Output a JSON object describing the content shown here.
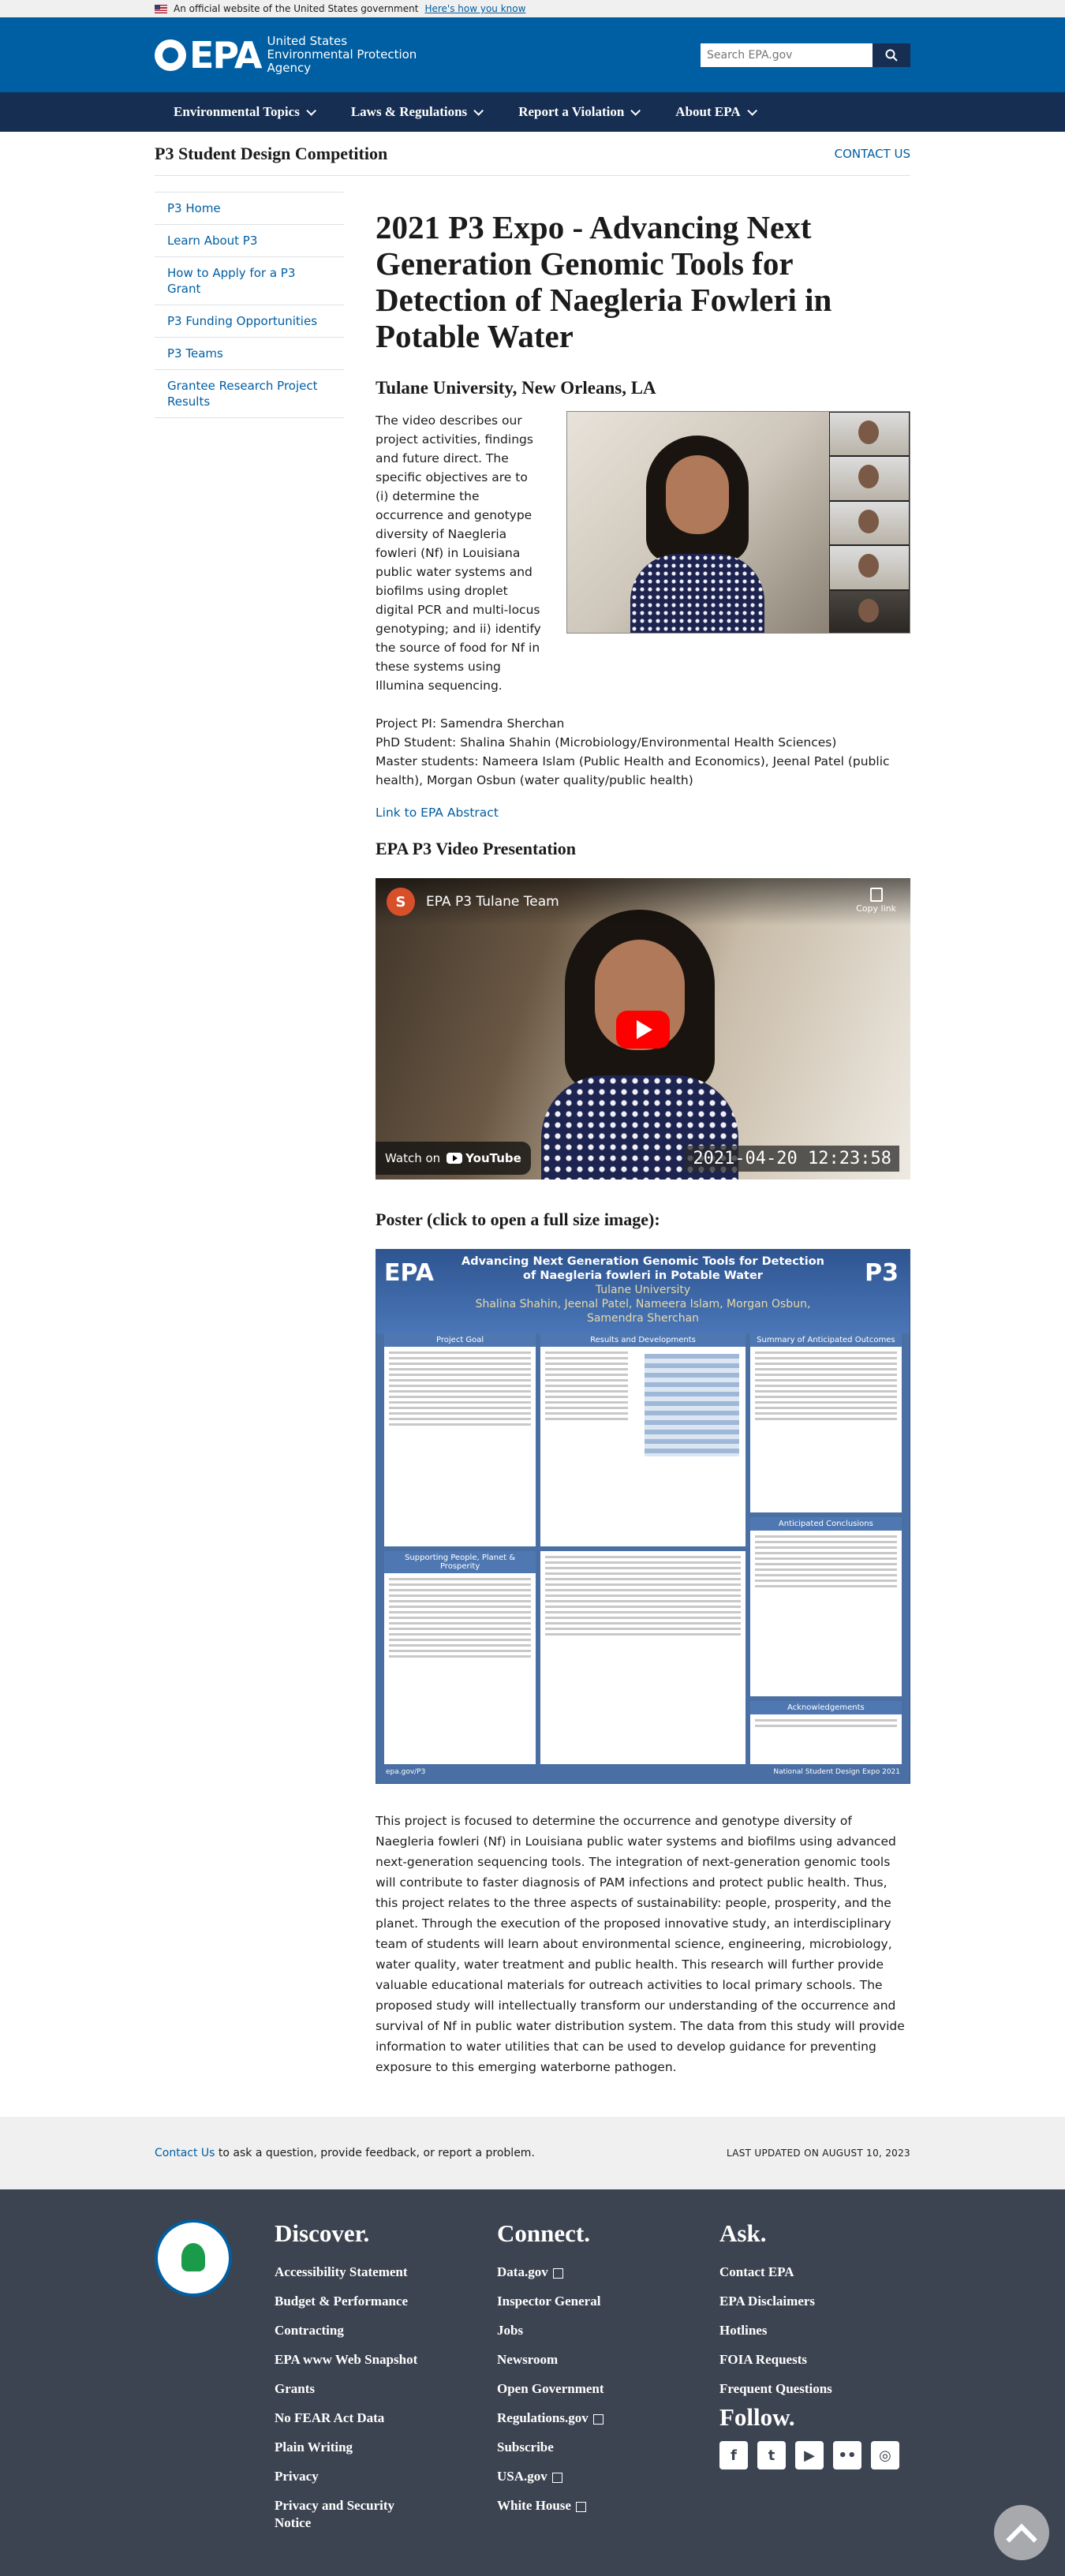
{
  "gov_banner": {
    "text": "An official website of the United States government",
    "link": "Here's how you know"
  },
  "header": {
    "logo": "EPA",
    "agency": [
      "United States",
      "Environmental Protection",
      "Agency"
    ],
    "search_placeholder": "Search EPA.gov"
  },
  "nav": [
    "Environmental Topics",
    "Laws & Regulations",
    "Report a Violation",
    "About EPA"
  ],
  "page": {
    "section_title": "P3 Student Design Competition",
    "contact": "CONTACT US"
  },
  "sidenav": [
    "P3 Home",
    "Learn About P3",
    "How to Apply for a P3 Grant",
    "P3 Funding Opportunities",
    "P3 Teams",
    "Grantee Research Project Results"
  ],
  "content": {
    "title": "2021 P3 Expo - Advancing Next Generation Genomic Tools for Detection of Naegleria Fowleri in Potable Water",
    "subtitle": "Tulane University, New Orleans, LA",
    "intro": "The video describes our project activities, findings and future direct. The specific objectives are to (i) determine the occurrence and genotype diversity of Naegleria fowleri (Nf) in Louisiana public water systems and biofilms using droplet digital PCR and multi-locus genotyping; and ii) identify the source of food for Nf in these systems using Illumina sequencing.",
    "credits": [
      "Project PI: Samendra Sherchan",
      "PhD Student: Shalina Shahin (Microbiology/Environmental Health Sciences)",
      "Master students: Nameera Islam (Public Health and Economics), Jeenal Patel (public health), Morgan Osbun (water quality/public health)"
    ],
    "abstract_link": "Link to EPA Abstract",
    "video_heading": "EPA P3 Video Presentation",
    "video": {
      "channel_initial": "S",
      "channel": "EPA P3 Tulane Team",
      "copy": "Copy link",
      "watch_on": "Watch on",
      "youtube": "YouTube",
      "timestamp": "2021-04-20  12:23:58"
    },
    "poster_heading": "Poster (click to open a full size image):",
    "poster": {
      "logo": "EPA",
      "title": "Advancing Next Generation Genomic Tools for Detection of Naegleria fowleri in Potable Water",
      "university": "Tulane University",
      "authors": "Shalina Shahin, Jeenal Patel, Nameera Islam, Morgan Osbun, Samendra Sherchan",
      "p3": "P3",
      "panels": [
        "Project Goal",
        "Results and Developments",
        "Summary of Anticipated Outcomes",
        "Supporting People, Planet & Prosperity",
        "",
        "Anticipated Conclusions",
        "",
        "",
        "Acknowledgements"
      ],
      "footer_left": "epa.gov/P3",
      "footer_right": "National Student Design Expo 2021"
    },
    "summary": "This project is focused to determine the occurrence and genotype diversity of Naegleria fowleri (Nf) in Louisiana public water systems and biofilms using advanced next-generation sequencing tools. The integration of next-generation genomic tools will contribute to faster diagnosis of PAM infections and protect public health. Thus, this project relates to the three aspects of sustainability: people, prosperity, and the planet. Through the execution of the proposed innovative study, an interdisciplinary team of students will learn about environmental science, engineering, microbiology, water quality, water treatment and public health. This research will further provide valuable educational materials for outreach activities to local primary schools. The proposed study will intellectually transform our understanding of the occurrence and survival of Nf in public water distribution system. The data from this study will provide information to water utilities that can be used to develop guidance for preventing exposure to this emerging waterborne pathogen."
  },
  "contact_strip": {
    "link": "Contact Us",
    "text": " to ask a question, provide feedback, or report a problem.",
    "updated": "LAST UPDATED ON AUGUST 10, 2023"
  },
  "footer": {
    "discover": {
      "title": "Discover.",
      "links": [
        "Accessibility Statement",
        "Budget & Performance",
        "Contracting",
        "EPA www Web Snapshot",
        "Grants",
        "No FEAR Act Data",
        "Plain Writing",
        "Privacy",
        "Privacy and Security Notice"
      ]
    },
    "connect": {
      "title": "Connect.",
      "links": [
        "Data.gov",
        "Inspector General",
        "Jobs",
        "Newsroom",
        "Open Government",
        "Regulations.gov",
        "Subscribe",
        "USA.gov",
        "White House"
      ]
    },
    "ask": {
      "title": "Ask.",
      "links": [
        "Contact EPA",
        "EPA Disclaimers",
        "Hotlines",
        "FOIA Requests",
        "Frequent Questions"
      ]
    },
    "follow": "Follow.",
    "social": [
      "f",
      "t",
      "▶",
      "••",
      "◎"
    ]
  }
}
